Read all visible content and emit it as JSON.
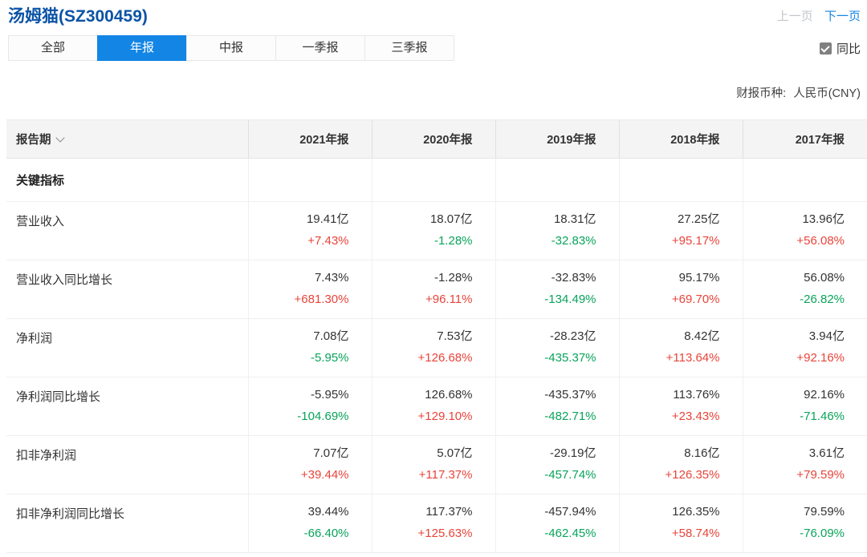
{
  "header": {
    "title": "汤姆猫(SZ300459)",
    "prev_label": "上一页",
    "next_label": "下一页"
  },
  "tabs": [
    {
      "label": "全部",
      "name": "tab-all",
      "active": false
    },
    {
      "label": "年报",
      "name": "tab-annual",
      "active": true
    },
    {
      "label": "中报",
      "name": "tab-semiannual",
      "active": false
    },
    {
      "label": "一季报",
      "name": "tab-q1",
      "active": false
    },
    {
      "label": "三季报",
      "name": "tab-q3",
      "active": false
    }
  ],
  "yoy": {
    "label": "同比",
    "checked": true
  },
  "currency": {
    "label": "财报币种:",
    "value": "人民币(CNY)"
  },
  "table": {
    "first_header": "报告期",
    "sort_icon": "chevron-down-icon",
    "period_headers": [
      "2021年报",
      "2020年报",
      "2019年报",
      "2018年报",
      "2017年报"
    ],
    "section_header": "关键指标",
    "rows": [
      {
        "label": "营业收入",
        "cells": [
          {
            "value": "19.41亿",
            "change": "+7.43%",
            "dir": "up"
          },
          {
            "value": "18.07亿",
            "change": "-1.28%",
            "dir": "down"
          },
          {
            "value": "18.31亿",
            "change": "-32.83%",
            "dir": "down"
          },
          {
            "value": "27.25亿",
            "change": "+95.17%",
            "dir": "up"
          },
          {
            "value": "13.96亿",
            "change": "+56.08%",
            "dir": "up"
          }
        ]
      },
      {
        "label": "营业收入同比增长",
        "cells": [
          {
            "value": "7.43%",
            "change": "+681.30%",
            "dir": "up"
          },
          {
            "value": "-1.28%",
            "change": "+96.11%",
            "dir": "up"
          },
          {
            "value": "-32.83%",
            "change": "-134.49%",
            "dir": "down"
          },
          {
            "value": "95.17%",
            "change": "+69.70%",
            "dir": "up"
          },
          {
            "value": "56.08%",
            "change": "-26.82%",
            "dir": "down"
          }
        ]
      },
      {
        "label": "净利润",
        "cells": [
          {
            "value": "7.08亿",
            "change": "-5.95%",
            "dir": "down"
          },
          {
            "value": "7.53亿",
            "change": "+126.68%",
            "dir": "up"
          },
          {
            "value": "-28.23亿",
            "change": "-435.37%",
            "dir": "down"
          },
          {
            "value": "8.42亿",
            "change": "+113.64%",
            "dir": "up"
          },
          {
            "value": "3.94亿",
            "change": "+92.16%",
            "dir": "up"
          }
        ]
      },
      {
        "label": "净利润同比增长",
        "cells": [
          {
            "value": "-5.95%",
            "change": "-104.69%",
            "dir": "down"
          },
          {
            "value": "126.68%",
            "change": "+129.10%",
            "dir": "up"
          },
          {
            "value": "-435.37%",
            "change": "-482.71%",
            "dir": "down"
          },
          {
            "value": "113.76%",
            "change": "+23.43%",
            "dir": "up"
          },
          {
            "value": "92.16%",
            "change": "-71.46%",
            "dir": "down"
          }
        ]
      },
      {
        "label": "扣非净利润",
        "cells": [
          {
            "value": "7.07亿",
            "change": "+39.44%",
            "dir": "up"
          },
          {
            "value": "5.07亿",
            "change": "+117.37%",
            "dir": "up"
          },
          {
            "value": "-29.19亿",
            "change": "-457.74%",
            "dir": "down"
          },
          {
            "value": "8.16亿",
            "change": "+126.35%",
            "dir": "up"
          },
          {
            "value": "3.61亿",
            "change": "+79.59%",
            "dir": "up"
          }
        ]
      },
      {
        "label": "扣非净利润同比增长",
        "cells": [
          {
            "value": "39.44%",
            "change": "-66.40%",
            "dir": "down"
          },
          {
            "value": "117.37%",
            "change": "+125.63%",
            "dir": "up"
          },
          {
            "value": "-457.94%",
            "change": "-462.45%",
            "dir": "down"
          },
          {
            "value": "126.35%",
            "change": "+58.74%",
            "dir": "up"
          },
          {
            "value": "79.59%",
            "change": "-76.09%",
            "dir": "down"
          }
        ]
      }
    ]
  },
  "colors": {
    "up_red": "#e8443a",
    "down_green": "#09a35a",
    "accent_blue": "#1385e5",
    "title_blue": "#0b53a6"
  }
}
